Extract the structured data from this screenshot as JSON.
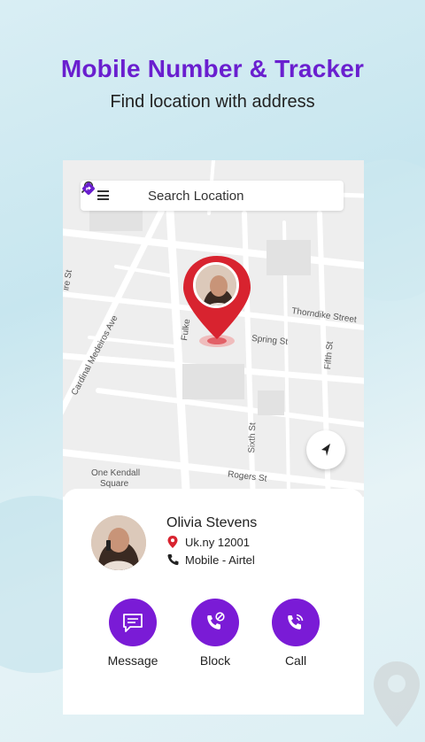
{
  "header": {
    "title": "Mobile Number & Tracker",
    "subtitle": "Find location with address"
  },
  "map": {
    "search_placeholder": "Search Location",
    "streets": [
      "Thorndike Street",
      "Spring St",
      "Fifth St",
      "Sixth St",
      "Rogers St",
      "Cardinal Medeiros Ave",
      "Fulke",
      "ire St",
      "One Kendall",
      "Square"
    ]
  },
  "contact": {
    "name": "Olivia Stevens",
    "address": "Uk.ny 12001",
    "carrier": "Mobile - Airtel"
  },
  "actions": {
    "message": "Message",
    "block": "Block",
    "call": "Call"
  },
  "colors": {
    "accent": "#7a1bd6",
    "title": "#6a1fcf",
    "pin": "#d8232f"
  }
}
